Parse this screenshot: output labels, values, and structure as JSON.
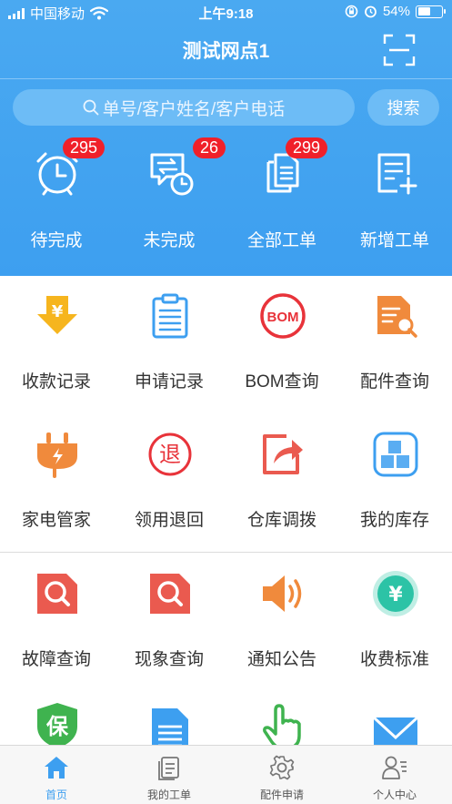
{
  "status_bar": {
    "carrier": "中国移动",
    "time": "上午9:18",
    "battery": "54%",
    "battery_level": 0.54
  },
  "header": {
    "title": "测试网点1"
  },
  "search": {
    "placeholder": "单号/客户姓名/客户电话",
    "button_label": "搜索"
  },
  "summary": [
    {
      "label": "待完成",
      "badge": "295",
      "icon": "alarm-clock-icon"
    },
    {
      "label": "未完成",
      "badge": "26",
      "icon": "pending-chat-icon"
    },
    {
      "label": "全部工单",
      "badge": "299",
      "icon": "documents-icon"
    },
    {
      "label": "新增工单",
      "badge": "",
      "icon": "add-document-icon"
    }
  ],
  "functions": [
    {
      "label": "收款记录",
      "icon": "yuan-arrow-icon",
      "color": "#f6b51e"
    },
    {
      "label": "申请记录",
      "icon": "clipboard-icon",
      "color": "#3d9ff0"
    },
    {
      "label": "BOM查询",
      "icon": "bom-icon",
      "icon_text": "BOM",
      "color": "#e8333a"
    },
    {
      "label": "配件查询",
      "icon": "parts-search-icon",
      "color": "#f08a3c"
    },
    {
      "label": "家电管家",
      "icon": "plug-icon",
      "color": "#f08a3c"
    },
    {
      "label": "领用退回",
      "icon": "return-icon",
      "icon_text": "退",
      "color": "#e8333a"
    },
    {
      "label": "仓库调拨",
      "icon": "share-icon",
      "color": "#ea5a4f"
    },
    {
      "label": "我的库存",
      "icon": "boxes-icon",
      "color": "#3d9ff0"
    },
    {
      "label": "故障查询",
      "icon": "fault-search-icon",
      "color": "#ea5a4f"
    },
    {
      "label": "现象查询",
      "icon": "symptom-search-icon",
      "color": "#ea5a4f"
    },
    {
      "label": "通知公告",
      "icon": "speaker-icon",
      "color": "#f08a3c"
    },
    {
      "label": "收费标准",
      "icon": "yuan-coin-icon",
      "color": "#2cc3a6"
    },
    {
      "label": "",
      "icon": "warranty-shield-icon",
      "icon_text": "保",
      "color": "#3fb34f"
    },
    {
      "label": "",
      "icon": "document-icon",
      "color": "#3d9ff0"
    },
    {
      "label": "",
      "icon": "pointer-hand-icon",
      "color": "#3fb34f"
    },
    {
      "label": "",
      "icon": "mail-icon",
      "color": "#3d9ff0"
    }
  ],
  "tabbar": [
    {
      "label": "首页",
      "icon": "home-icon",
      "active": true
    },
    {
      "label": "我的工单",
      "icon": "orders-icon",
      "active": false
    },
    {
      "label": "配件申请",
      "icon": "gear-icon",
      "active": false
    },
    {
      "label": "个人中心",
      "icon": "profile-icon",
      "active": false
    }
  ],
  "colors": {
    "primary": "#3d9ff0",
    "badge": "#f0202a"
  }
}
